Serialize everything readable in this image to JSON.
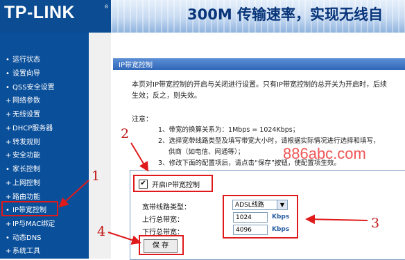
{
  "header": {
    "logo_text": "TP-LINK",
    "logo_tm": "®",
    "slogan": "300M 传输速率，实现无线自"
  },
  "sidebar": {
    "items": [
      {
        "bullet": "•",
        "label": "运行状态"
      },
      {
        "bullet": "•",
        "label": "设置向导"
      },
      {
        "bullet": "•",
        "label": "QSS安全设置"
      },
      {
        "bullet": "+",
        "label": "网络参数"
      },
      {
        "bullet": "+",
        "label": "无线设置"
      },
      {
        "bullet": "+",
        "label": "DHCP服务器"
      },
      {
        "bullet": "+",
        "label": "转发规则"
      },
      {
        "bullet": "+",
        "label": "安全功能"
      },
      {
        "bullet": "•",
        "label": "家长控制"
      },
      {
        "bullet": "+",
        "label": "上网控制"
      },
      {
        "bullet": "+",
        "label": "路由功能"
      },
      {
        "bullet": "•",
        "label": "IP带宽控制"
      },
      {
        "bullet": "+",
        "label": "IP与MAC绑定"
      },
      {
        "bullet": "•",
        "label": "动态DNS"
      },
      {
        "bullet": "+",
        "label": "系统工具"
      }
    ]
  },
  "main": {
    "title": "IP带宽控制",
    "description_line1": "本页对IP带宽控制的开启与关闭进行设置。只有IP带宽控制的总开关为开启时，后续",
    "description_line2": "生效；反之，则失效。",
    "note_title": "注意：",
    "note_1": "1、带宽的换算关系为：1Mbps = 1024Kbps；",
    "note_2": "2、选择宽带线路类型及填写带宽大小时，请根据实际情况进行选择和填写，",
    "note_2b": "供商（如电信、网通等）；",
    "note_3": "3、修改下面的配置项后，请点击“保存”按钮，使配置项生效。"
  },
  "form": {
    "enable_label": "开启IP带宽控制",
    "enable_checked": true,
    "line_type_label": "宽带线路类型：",
    "line_type_value": "ADSL线路",
    "upload_label": "上行总带宽：",
    "upload_value": "1024",
    "download_label": "下行总带宽：",
    "download_value": "4096",
    "unit": "Kbps",
    "save_label": "保 存"
  },
  "annotations": {
    "n1": "1",
    "n2": "2",
    "n3": "3",
    "n4": "4",
    "color": "#e01a1a"
  },
  "watermark": "886abc.com"
}
